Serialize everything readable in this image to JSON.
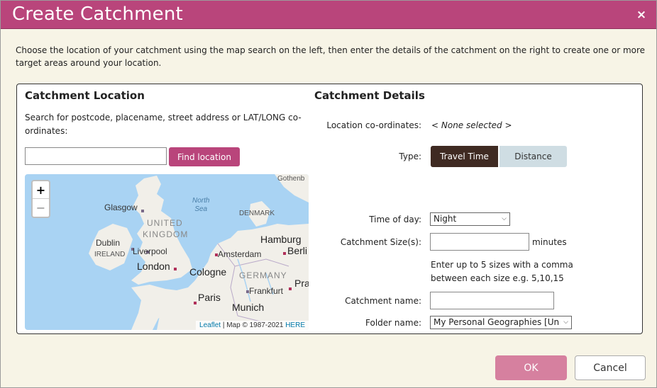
{
  "window": {
    "title": "Create Catchment",
    "close_glyph": "×"
  },
  "intro": "Choose the location of your catchment using the map search on the left, then enter the details of the catchment on the right to create one or more target areas around your location.",
  "location": {
    "heading": "Catchment Location",
    "search_label": "Search for postcode, placename, street address or LAT/LONG co-ordinates:",
    "search_value": "",
    "find_button": "Find location",
    "map": {
      "zoom_in": "+",
      "zoom_out": "−",
      "labels": {
        "north_sea_1": "North",
        "north_sea_2": "Sea",
        "glasgow": "Glasgow",
        "united": "UNITED",
        "kingdom": "KINGDOM",
        "dublin": "Dublin",
        "ireland": "IRELAND",
        "liverpool": "Liverpool",
        "london": "London",
        "amsterdam": "Amsterdam",
        "hamburg": "Hamburg",
        "berlin": "Berli",
        "cologne": "Cologne",
        "germany": "GERMANY",
        "frankfurt": "Frankfurt",
        "prague": "Pra",
        "paris": "Paris",
        "munich": "Munich",
        "denmark": "DENMARK",
        "gothenburg": "Gothenb"
      },
      "attribution_leaflet": "Leaflet",
      "attribution_text": " | Map © 1987-2021 ",
      "attribution_here": "HERE"
    }
  },
  "details": {
    "heading": "Catchment Details",
    "coord_label": "Location co-ordinates:",
    "coord_value": "< None selected >",
    "type_label": "Type:",
    "type_options": [
      "Travel Time",
      "Distance"
    ],
    "time_label": "Time of day:",
    "time_value": "Night",
    "size_label": "Catchment Size(s):",
    "size_value": "",
    "size_unit": "minutes",
    "size_hint": "Enter up to 5 sizes with a comma between each size e.g. 5,10,15",
    "name_label": "Catchment name:",
    "name_value": "",
    "folder_label": "Folder name:",
    "folder_value": "My Personal Geographies [Un"
  },
  "footer": {
    "ok": "OK",
    "cancel": "Cancel"
  },
  "colors": {
    "titlebar": "#b9457b",
    "find_button": "#b9457b",
    "travel_tab": "#3f2a22",
    "distance_tab": "#cfdde3",
    "ok_button": "#d6809f",
    "background": "#f7f4e6"
  }
}
